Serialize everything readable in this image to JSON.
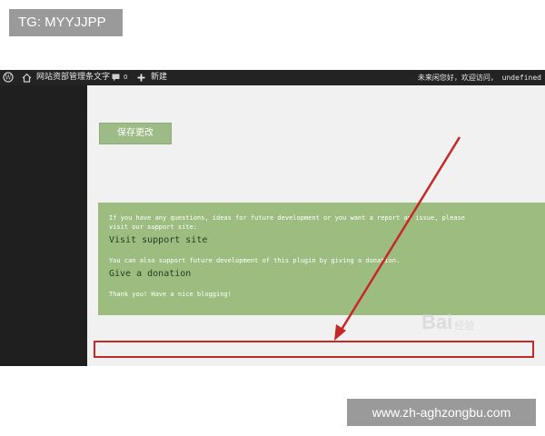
{
  "overlay": {
    "tag_label": "TG: MYYJJPP",
    "url_label": "www.zh-aghzongbu.com"
  },
  "adminbar": {
    "site_title": "网站资部管理条文字",
    "comment_count": "0",
    "new_label": "新建",
    "greeting": "未来闲您好，欢迎访问， undefined",
    "icons": [
      "wordpress-logo-icon",
      "home-icon",
      "comment-icon",
      "plus-icon"
    ]
  },
  "main": {
    "save_label": "保存更改",
    "support_intro": "If you have any questions, ideas for future development or you want a report an issue, please",
    "support_intro2": "visit our support site:",
    "support_link": "Visit support site",
    "donation_intro": "You can also support future development of this plugin by giving a donation.",
    "donation_link": "Give a donation",
    "closing": "Thank you! Have a nice blogging!"
  },
  "watermark": {
    "brand": "Bai",
    "suffix": "经验"
  },
  "colors": {
    "admin_bar": "#232323",
    "sidebar": "#1f1f1f",
    "button_green": "#9dbb86",
    "box_green": "#9dbd80",
    "annotation_red": "#c62828"
  }
}
